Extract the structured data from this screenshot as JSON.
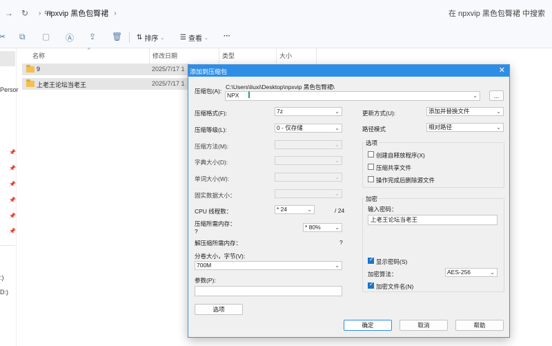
{
  "address_bar": {
    "path": [
      "npxvip 黑色包臀裙"
    ],
    "search_placeholder": "在 npxvip 黑色包臀裙 中搜索"
  },
  "toolbar": {
    "sort_label": "排序",
    "view_label": "查看",
    "more_label": "···"
  },
  "sidebar": {
    "partial_labels": [
      "Persor",
      ":)",
      "D:)"
    ]
  },
  "file_list": {
    "columns": [
      "名称",
      "修改日期",
      "类型",
      "大小"
    ],
    "rows": [
      {
        "name": "9",
        "date": "2025/7/17 1"
      },
      {
        "name": "上老王论坛当老王",
        "date": "2025/7/17 1"
      }
    ]
  },
  "dialog": {
    "title": "添加到压缩包",
    "archive_label": "压缩包(A):",
    "archive_dir": "C:\\Users\\liuxi\\Desktop\\npxvip 黑色包臀裙\\",
    "archive_name": "NPX",
    "browse_label": "...",
    "format_label": "压缩格式(F):",
    "format_value": "7z",
    "level_label": "压缩等级(L):",
    "level_value": "0 - 仅存储",
    "method_label": "压缩方法(M):",
    "dict_label": "字典大小(D):",
    "word_label": "单词大小(W):",
    "solid_label": "固实数据大小：",
    "cpu_label": "CPU 线程数：",
    "cpu_value": "* 24",
    "cpu_total": "/ 24",
    "mem_comp_label": "压缩所需内存：",
    "mem_comp_q": "?",
    "mem_comp_value": "* 80%",
    "mem_decomp_label": "解压缩所需内存：",
    "mem_decomp_q": "?",
    "split_label": "分卷大小，字节(V):",
    "split_value": "700M",
    "params_label": "参数(P):",
    "params_value": "",
    "options_button": "选项",
    "update_label": "更新方式(U):",
    "update_value": "添加并替换文件",
    "path_mode_label": "路径模式",
    "path_mode_value": "相对路径",
    "options_group": "选项",
    "opt_sfx": "创建自释放程序(X)",
    "opt_shared": "压缩共享文件",
    "opt_delete": "操作完成后删除源文件",
    "encrypt_group": "加密",
    "password_label": "输入密码：",
    "password_value": "上老王论坛当老王",
    "show_password": "显示密码(S)",
    "enc_method_label": "加密算法：",
    "enc_method_value": "AES-256",
    "enc_names": "加密文件名(N)",
    "ok": "确定",
    "cancel": "取消",
    "help": "帮助"
  }
}
